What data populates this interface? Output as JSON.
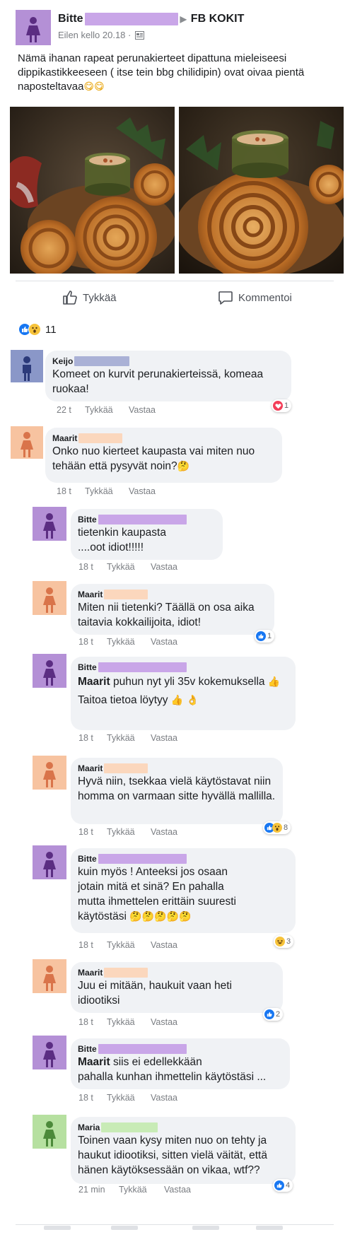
{
  "post": {
    "author": "Bitte",
    "group": "FB KOKIT",
    "timestamp": "Eilen kello 20.18 ·",
    "text": "Nämä ihanan rapeat perunakierteet dipattuna mieleiseesi dippikastikkeeseen ( itse tein bbg chilidipin) ovat oivaa pientä napostelta­vaa",
    "text_emoji": "😋😋",
    "colors": {
      "bitte": "#b490d6",
      "keijo": "#8a97c8",
      "maarit": "#f7c3a0",
      "maria": "#b6e0a0",
      "brand": "#1877f2"
    }
  },
  "actions": {
    "like": "Tykkää",
    "comment": "Kommentoi"
  },
  "reactions": {
    "count": "11",
    "icons": [
      "like-icon",
      "wow-icon"
    ]
  },
  "comments": [
    {
      "author": "Keijo",
      "text": "Komeet on kurvit perunakierteissä, komeaa ruokaa!",
      "time": "22 t",
      "like": "Tykkää",
      "reply": "Vastaa",
      "badge": "1",
      "badge_icons": [
        "love-icon"
      ]
    },
    {
      "author": "Maarit",
      "text": "Onko nuo kierteet kaupasta vai miten nuo tehään että pysyvät noin?",
      "emoji": "🤔",
      "time": "18 t",
      "like": "Tykkää",
      "reply": "Vastaa"
    },
    {
      "author": "Bitte",
      "text_lines": [
        "tietenkin kaupasta",
        "....oot idiot!!!!!"
      ],
      "time": "18 t",
      "like": "Tykkää",
      "reply": "Vastaa"
    },
    {
      "author": "Maarit",
      "text": "Miten nii tietenki? Täällä on osa aika taitavia kokkailijoita, idiot!",
      "time": "18 t",
      "like": "Tykkää",
      "reply": "Vastaa",
      "badge": "1",
      "badge_icons": [
        "like-icon"
      ]
    },
    {
      "author": "Bitte",
      "mention": "Maarit",
      "text": "puhun nyt yli 35v kokemuksella",
      "text2": "Taitoa tietoa löytyy",
      "emoji": "👍",
      "emoji_end": "👌",
      "time": "18 t",
      "like": "Tykkää",
      "reply": "Vastaa"
    },
    {
      "author": "Maarit",
      "text": "Hyvä niin, tsekkaa vielä käytöstavat niin homma on varmaan sitte hyvällä mallilla.",
      "time": "18 t",
      "like": "Tykkää",
      "reply": "Vastaa",
      "badge": "8",
      "badge_icons": [
        "like-icon",
        "wow-icon"
      ]
    },
    {
      "author": "Bitte",
      "text_lines": [
        "kuin myös ! Anteeksi jos osaan",
        "jotain mitä et sinä? En pahalla",
        "mutta ihmettelen erittäin suuresti",
        "käytöstäsi"
      ],
      "emoji": "🤔🤔🤔🤔🤔",
      "time": "18 t",
      "like": "Tykkää",
      "reply": "Vastaa",
      "badge": "3",
      "badge_icons": [
        "haha-icon"
      ]
    },
    {
      "author": "Maarit",
      "text": "Juu ei mitään, haukuit vaan heti idiootiksi",
      "time": "18 t",
      "like": "Tykkää",
      "reply": "Vastaa",
      "badge": "2",
      "badge_icons": [
        "like-icon"
      ]
    },
    {
      "author": "Bitte",
      "mention": "Maarit",
      "text": "siis ei edellekkään",
      "text2": "pahalla kunhan ihmettelin käytöstäsi ...",
      "time": "18 t",
      "like": "Tykkää",
      "reply": "Vastaa"
    },
    {
      "author": "Maria",
      "text": "Toinen vaan kysy miten nuo on tehty ja haukut idiootiksi, sitten vielä väität, että hänen käytöksessään on vikaa, wtf??",
      "time": "21 min",
      "like": "Tykkää",
      "reply": "Vastaa",
      "badge": "4",
      "badge_icons": [
        "like-icon"
      ]
    }
  ]
}
